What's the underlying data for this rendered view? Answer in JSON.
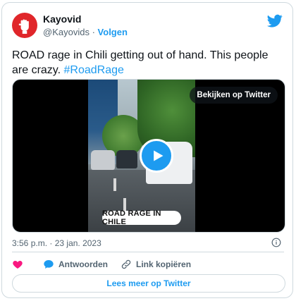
{
  "user": {
    "name": "Kayovid",
    "handle": "@Kayovids",
    "separator": "·",
    "follow_label": "Volgen"
  },
  "tweet": {
    "text": "ROAD rage in Chili getting out of hand. This people are crazy. ",
    "hashtag": "#RoadRage"
  },
  "media": {
    "caption": "ROAD RAGE IN CHILE",
    "watch_label": "Bekijken op Twitter"
  },
  "meta": {
    "time": "3:56 p.m.",
    "separator": "·",
    "date": "23 jan. 2023"
  },
  "actions": {
    "reply_label": "Antwoorden",
    "copy_link_label": "Link kopiëren"
  },
  "more_label": "Lees meer op Twitter",
  "icons": {
    "brand": "twitter-bird-icon",
    "like": "heart-icon",
    "reply": "speech-bubble-icon",
    "link": "link-icon",
    "info": "info-icon",
    "play": "play-icon"
  },
  "colors": {
    "accent": "#1d9bf0",
    "like": "#f91880",
    "avatar": "#e0262a",
    "text": "#0f1419",
    "secondary": "#536471",
    "border": "#cfd9de"
  }
}
